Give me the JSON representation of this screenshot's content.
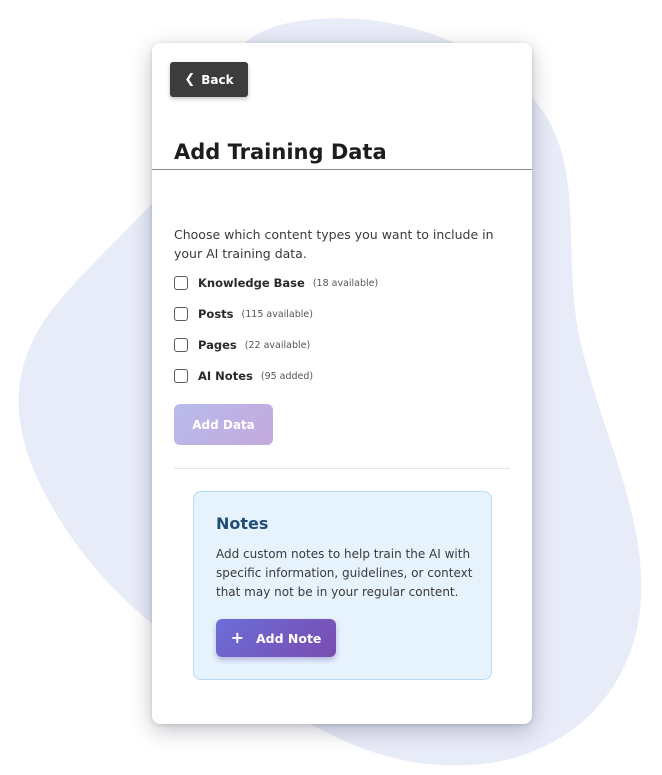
{
  "header": {
    "back_label": "Back",
    "title": "Add Training Data"
  },
  "content": {
    "intro": "Choose which content types you want to include in your AI training data.",
    "options": [
      {
        "label": "Knowledge Base",
        "count": "(18 available)",
        "checked": false
      },
      {
        "label": "Posts",
        "count": "(115 available)",
        "checked": false
      },
      {
        "label": "Pages",
        "count": "(22 available)",
        "checked": false
      },
      {
        "label": "AI Notes",
        "count": "(95 added)",
        "checked": false
      }
    ],
    "add_data_label": "Add Data"
  },
  "notes": {
    "title": "Notes",
    "description": "Add custom notes to help train the AI with specific information, guidelines, or context that may not be in your regular content.",
    "add_note_label": "Add Note"
  },
  "colors": {
    "blob": "#e8ebf8",
    "accent_start": "#6a6fd8",
    "accent_end": "#7a4bb0",
    "notes_bg": "#e7f3fc",
    "notes_title": "#1f4f76"
  },
  "icons": {
    "back": "chevron-left-icon",
    "add_note": "plus-icon"
  }
}
